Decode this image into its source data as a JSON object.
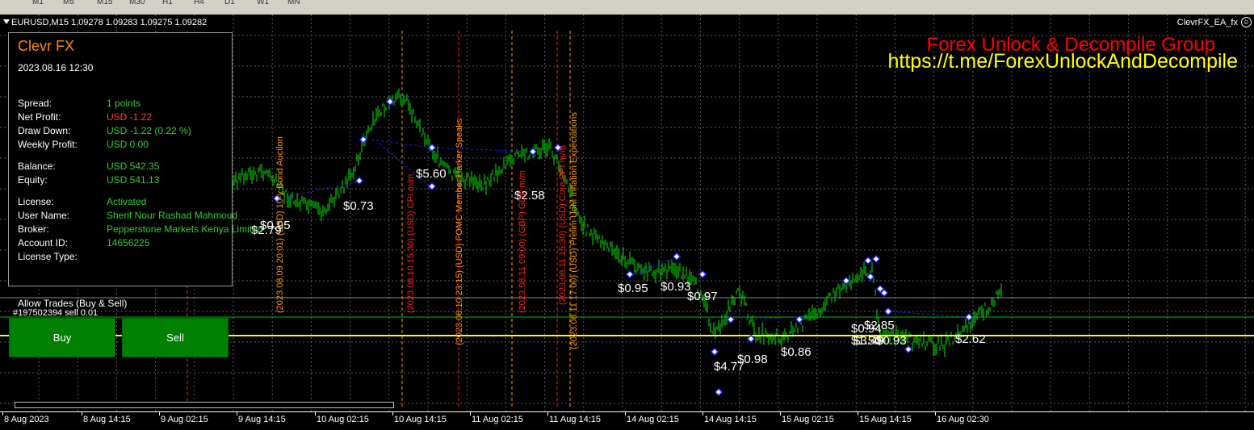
{
  "timeframes": [
    "M1",
    "M5",
    "M15",
    "M30",
    "H1",
    "H4",
    "D1",
    "W1",
    "MN"
  ],
  "chart": {
    "symbol_info": "EURUSD,M15  1.09278 1.09283 1.09275 1.09282",
    "ea_name": "ClevrFX_EA_fx",
    "watermark_title": "Forex Unlock & Decompile Group",
    "watermark_url": "https://t.me/ForexUnlockAndDecompile"
  },
  "panel": {
    "title": "Clevr FX",
    "datetime": "2023.08.16 12:30",
    "rows": [
      {
        "label": "Spread:",
        "value": "1 points"
      },
      {
        "label": "Net Profit:",
        "value": "USD -1.22"
      },
      {
        "label": "Draw Down:",
        "value": "USD -1.22 (0.22 %)"
      },
      {
        "label": "Weekly Profit:",
        "value": "USD 0.00"
      },
      {
        "label": "Balance:",
        "value": "USD 542.35"
      },
      {
        "label": "Equity:",
        "value": "USD 541.13"
      },
      {
        "label": "License:",
        "value": "Activated"
      },
      {
        "label": "User Name:",
        "value": "Sherif Nour Rashad Mahmoud"
      },
      {
        "label": "Broker:",
        "value": "Pepperstone Markets Kenya Limited"
      },
      {
        "label": "Account ID:",
        "value": "14656225"
      },
      {
        "label": "License Type:",
        "value": ""
      }
    ]
  },
  "trading": {
    "allow_trades": "Allow Trades (Buy & Sell)",
    "order_label": "#197502394 sell 0.01",
    "buy_label": "Buy",
    "sell_label": "Sell"
  },
  "news_events": [
    "(2023.08.09 20:01) (USD) 10-y Bond Auction",
    "(2023.08.10 15:30) (USD) CPI m/m",
    "(2023.08.10 23:15) (USD) FOMC Member Harker Speaks",
    "(2023.08.11 09:00) (GBP) GDP m/m",
    "(2023.08.11 15:30) (USD) Core PPI m/m",
    "(2023.08.11 17:00) (USD) Prelim UoM Inflation Expectations"
  ],
  "profit_labels": [
    "$2.79",
    "$0.95",
    "$0.73",
    "$5.60",
    "$2.58",
    "$0.95",
    "$0.93",
    "$0.97",
    "$4.77",
    "$0.98",
    "$0.86",
    "$0.94",
    "$2.85",
    "$1.50",
    "$3.40",
    "$0.93",
    "$2.62"
  ],
  "xaxis_labels": [
    "8 Aug 2023",
    "8 Aug 14:15",
    "9 Aug 02:15",
    "9 Aug 14:15",
    "10 Aug 02:15",
    "10 Aug 14:15",
    "11 Aug 02:15",
    "11 Aug 14:15",
    "14 Aug 02:15",
    "14 Aug 14:15",
    "15 Aug 02:15",
    "15 Aug 14:15",
    "16 Aug 02:30"
  ],
  "colors": {
    "candle": "#00c000",
    "grid": "#5a5a5a",
    "bid_line": "#ffff00",
    "ask_line": "#00c000",
    "news_red": "#ff2020",
    "news_orange": "#ff9900",
    "trade_line": "#2020ff",
    "panel_title": "#ff8c00",
    "watermark_red": "#ff0000",
    "watermark_yellow": "#ffff00"
  }
}
